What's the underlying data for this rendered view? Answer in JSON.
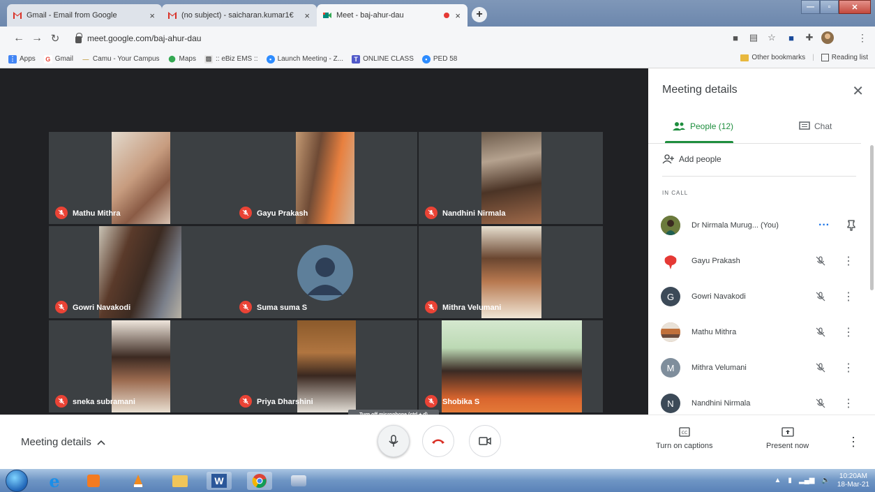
{
  "browser": {
    "tabs": [
      {
        "title": "Gmail - Email from Google",
        "close": "×"
      },
      {
        "title": "(no subject) - saicharan.kumar1€",
        "close": "×"
      },
      {
        "title": "Meet - baj-ahur-dau",
        "close": "×"
      }
    ],
    "new_tab": "+",
    "url": "meet.google.com/baj-ahur-dau",
    "bookmarks": [
      "Apps",
      "Gmail",
      "Camu - Your Campus",
      "Maps",
      ":: eBiz EMS ::",
      "Launch Meeting - Z...",
      "ONLINE CLASS",
      "PED 58"
    ],
    "other_bookmarks": "Other bookmarks",
    "reading_list": "Reading list"
  },
  "tiles": [
    {
      "name": "Mathu Mithra"
    },
    {
      "name": "Gayu Prakash"
    },
    {
      "name": "Nandhini Nirmala"
    },
    {
      "name": "Gowri Navakodi"
    },
    {
      "name": "Suma suma S"
    },
    {
      "name": "Mithra Velumani"
    },
    {
      "name": "sneka subramani"
    },
    {
      "name": "Priya Dharshini"
    },
    {
      "name": "Shobika S"
    }
  ],
  "tooltip": "Turn off microphone (ctrl + d)",
  "panel": {
    "title": "Meeting details",
    "tab_people": "People (12)",
    "tab_chat": "Chat",
    "add_people": "Add people",
    "in_call": "IN CALL",
    "participants": [
      {
        "name": "Dr Nirmala Murug... (You)",
        "initial": "",
        "color": "#6b7a3c"
      },
      {
        "name": "Gayu Prakash",
        "initial": "",
        "color": "#e53935"
      },
      {
        "name": "Gowri Navakodi",
        "initial": "G",
        "color": "#3c4a58"
      },
      {
        "name": "Mathu Mithra",
        "initial": "",
        "color": "#c0703a"
      },
      {
        "name": "Mithra Velumani",
        "initial": "M",
        "color": "#7f8e9c"
      },
      {
        "name": "Nandhini Nirmala",
        "initial": "N",
        "color": "#3c4a58"
      }
    ]
  },
  "controls": {
    "meeting_details": "Meeting details",
    "captions": "Turn on captions",
    "present": "Present now"
  },
  "taskbar": {
    "time": "10:20AM",
    "date": "18-Mar-21"
  }
}
